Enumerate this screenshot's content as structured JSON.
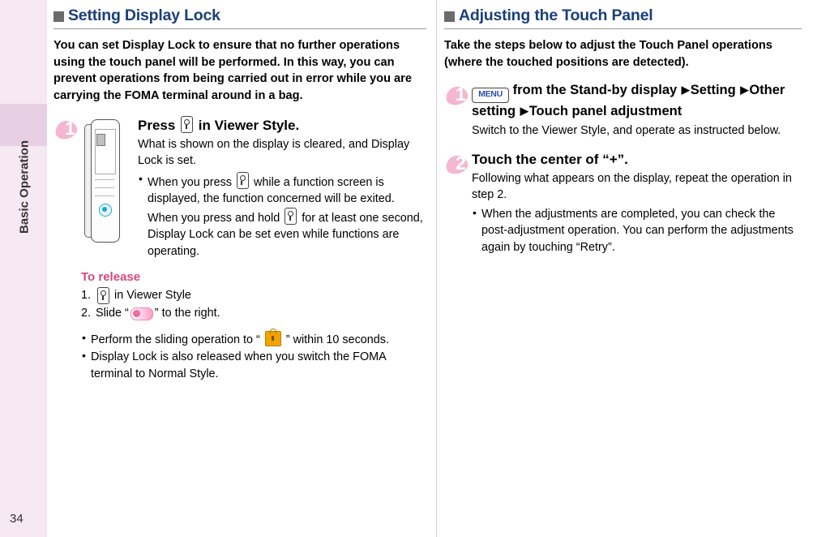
{
  "sidebar": {
    "chapter_label": "Basic Operation",
    "page_number": "34"
  },
  "left_column": {
    "heading": "Setting Display Lock",
    "intro": "You can set Display Lock to ensure that no further operations using the touch panel will be performed. In this way, you can prevent operations from being carried out in error while you are carrying the FOMA terminal around in a bag.",
    "step1": {
      "number": "1",
      "title_before": "Press",
      "title_after": "in Viewer Style.",
      "text": "What is shown on the display is cleared, and Display Lock is set.",
      "bullet1_a": "When you press",
      "bullet1_b": "while a function screen is displayed, the function concerned will be exited. When you press and hold",
      "bullet1_c": "for at least one second, Display Lock can be set even while functions are operating."
    },
    "to_release": {
      "title": "To release",
      "item1_index": "1.",
      "item1_text_after": "in Viewer Style",
      "item2_index": "2.",
      "item2_text_before": "Slide “",
      "item2_text_after": "” to the right."
    },
    "bullets": [
      {
        "before": "Perform the sliding operation to “",
        "after": "” within 10 seconds."
      },
      {
        "text": "Display Lock is also released when you switch the FOMA terminal to Normal Style."
      }
    ]
  },
  "right_column": {
    "heading": "Adjusting the Touch Panel",
    "intro": "Take the steps below to adjust the Touch Panel operations (where the touched positions are detected).",
    "step1": {
      "number": "1",
      "menu_key_label": "MENU",
      "title_part1": "from the Stand-by display",
      "title_part2": "Setting",
      "title_part3": "Other setting",
      "title_part4": "Touch panel adjustment",
      "text": "Switch to the Viewer Style, and operate as instructed below."
    },
    "step2": {
      "number": "2",
      "title": "Touch the center of “+”.",
      "text": "Following what appears on the display, repeat the operation in step 2.",
      "bullet": "When the adjustments are completed, you can check the post-adjustment operation. You can perform the adjustments again by touching “Retry”."
    }
  },
  "colors": {
    "heading_blue": "#1a3f7a",
    "accent_pink": "#d4497a",
    "sidebar_bg": "#f7e9f3",
    "sidebar_tab": "#e8d0e4"
  }
}
